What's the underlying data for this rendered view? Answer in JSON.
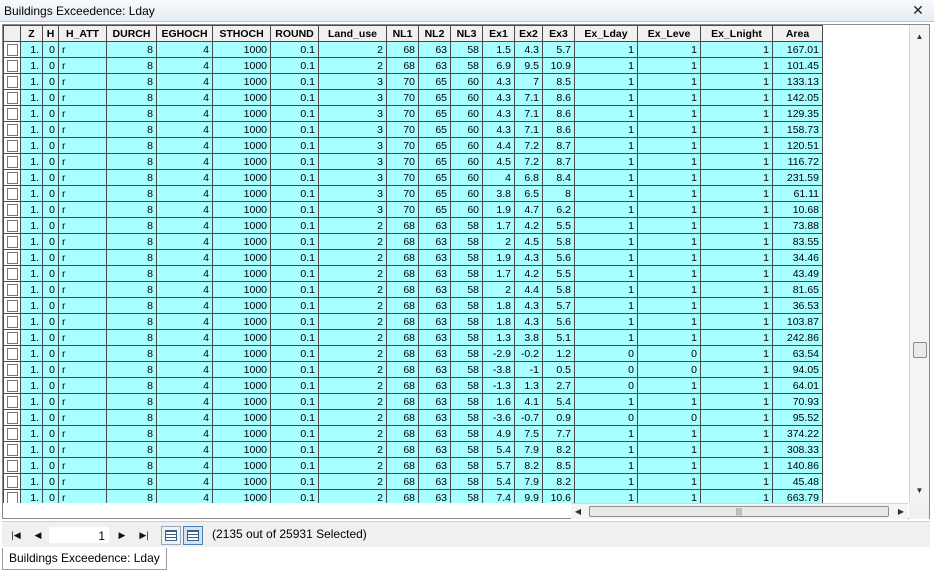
{
  "window": {
    "title": "Buildings Exceedence: Lday"
  },
  "table": {
    "columns": [
      "",
      "Z",
      "H",
      "H_ATT",
      "DURCH",
      "EGHOCH",
      "STHOCH",
      "ROUND",
      "Land_use",
      "NL1",
      "NL2",
      "NL3",
      "Ex1",
      "Ex2",
      "Ex3",
      "Ex_Lday",
      "Ex_Leve",
      "Ex_Lnight",
      "Area"
    ],
    "rows": [
      [
        "1.",
        "0",
        "r",
        "8",
        "4",
        "1000",
        "0.1",
        "2",
        "68",
        "63",
        "58",
        "1.5",
        "4.3",
        "5.7",
        "1",
        "1",
        "1",
        "167.01"
      ],
      [
        "1.",
        "0",
        "r",
        "8",
        "4",
        "1000",
        "0.1",
        "2",
        "68",
        "63",
        "58",
        "6.9",
        "9.5",
        "10.9",
        "1",
        "1",
        "1",
        "101.45"
      ],
      [
        "1.",
        "0",
        "r",
        "8",
        "4",
        "1000",
        "0.1",
        "3",
        "70",
        "65",
        "60",
        "4.3",
        "7",
        "8.5",
        "1",
        "1",
        "1",
        "133.13"
      ],
      [
        "1.",
        "0",
        "r",
        "8",
        "4",
        "1000",
        "0.1",
        "3",
        "70",
        "65",
        "60",
        "4.3",
        "7.1",
        "8.6",
        "1",
        "1",
        "1",
        "142.05"
      ],
      [
        "1.",
        "0",
        "r",
        "8",
        "4",
        "1000",
        "0.1",
        "3",
        "70",
        "65",
        "60",
        "4.3",
        "7.1",
        "8.6",
        "1",
        "1",
        "1",
        "129.35"
      ],
      [
        "1.",
        "0",
        "r",
        "8",
        "4",
        "1000",
        "0.1",
        "3",
        "70",
        "65",
        "60",
        "4.3",
        "7.1",
        "8.6",
        "1",
        "1",
        "1",
        "158.73"
      ],
      [
        "1.",
        "0",
        "r",
        "8",
        "4",
        "1000",
        "0.1",
        "3",
        "70",
        "65",
        "60",
        "4.4",
        "7.2",
        "8.7",
        "1",
        "1",
        "1",
        "120.51"
      ],
      [
        "1.",
        "0",
        "r",
        "8",
        "4",
        "1000",
        "0.1",
        "3",
        "70",
        "65",
        "60",
        "4.5",
        "7.2",
        "8.7",
        "1",
        "1",
        "1",
        "116.72"
      ],
      [
        "1.",
        "0",
        "r",
        "8",
        "4",
        "1000",
        "0.1",
        "3",
        "70",
        "65",
        "60",
        "4",
        "6.8",
        "8.4",
        "1",
        "1",
        "1",
        "231.59"
      ],
      [
        "1.",
        "0",
        "r",
        "8",
        "4",
        "1000",
        "0.1",
        "3",
        "70",
        "65",
        "60",
        "3.8",
        "6.5",
        "8",
        "1",
        "1",
        "1",
        "61.11"
      ],
      [
        "1.",
        "0",
        "r",
        "8",
        "4",
        "1000",
        "0.1",
        "3",
        "70",
        "65",
        "60",
        "1.9",
        "4.7",
        "6.2",
        "1",
        "1",
        "1",
        "10.68"
      ],
      [
        "1.",
        "0",
        "r",
        "8",
        "4",
        "1000",
        "0.1",
        "2",
        "68",
        "63",
        "58",
        "1.7",
        "4.2",
        "5.5",
        "1",
        "1",
        "1",
        "73.88"
      ],
      [
        "1.",
        "0",
        "r",
        "8",
        "4",
        "1000",
        "0.1",
        "2",
        "68",
        "63",
        "58",
        "2",
        "4.5",
        "5.8",
        "1",
        "1",
        "1",
        "83.55"
      ],
      [
        "1.",
        "0",
        "r",
        "8",
        "4",
        "1000",
        "0.1",
        "2",
        "68",
        "63",
        "58",
        "1.9",
        "4.3",
        "5.6",
        "1",
        "1",
        "1",
        "34.46"
      ],
      [
        "1.",
        "0",
        "r",
        "8",
        "4",
        "1000",
        "0.1",
        "2",
        "68",
        "63",
        "58",
        "1.7",
        "4.2",
        "5.5",
        "1",
        "1",
        "1",
        "43.49"
      ],
      [
        "1.",
        "0",
        "r",
        "8",
        "4",
        "1000",
        "0.1",
        "2",
        "68",
        "63",
        "58",
        "2",
        "4.4",
        "5.8",
        "1",
        "1",
        "1",
        "81.65"
      ],
      [
        "1.",
        "0",
        "r",
        "8",
        "4",
        "1000",
        "0.1",
        "2",
        "68",
        "63",
        "58",
        "1.8",
        "4.3",
        "5.7",
        "1",
        "1",
        "1",
        "36.53"
      ],
      [
        "1.",
        "0",
        "r",
        "8",
        "4",
        "1000",
        "0.1",
        "2",
        "68",
        "63",
        "58",
        "1.8",
        "4.3",
        "5.6",
        "1",
        "1",
        "1",
        "103.87"
      ],
      [
        "1.",
        "0",
        "r",
        "8",
        "4",
        "1000",
        "0.1",
        "2",
        "68",
        "63",
        "58",
        "1.3",
        "3.8",
        "5.1",
        "1",
        "1",
        "1",
        "242.86"
      ],
      [
        "1.",
        "0",
        "r",
        "8",
        "4",
        "1000",
        "0.1",
        "2",
        "68",
        "63",
        "58",
        "-2.9",
        "-0.2",
        "1.2",
        "0",
        "0",
        "1",
        "63.54"
      ],
      [
        "1.",
        "0",
        "r",
        "8",
        "4",
        "1000",
        "0.1",
        "2",
        "68",
        "63",
        "58",
        "-3.8",
        "-1",
        "0.5",
        "0",
        "0",
        "1",
        "94.05"
      ],
      [
        "1.",
        "0",
        "r",
        "8",
        "4",
        "1000",
        "0.1",
        "2",
        "68",
        "63",
        "58",
        "-1.3",
        "1.3",
        "2.7",
        "0",
        "1",
        "1",
        "64.01"
      ],
      [
        "1.",
        "0",
        "r",
        "8",
        "4",
        "1000",
        "0.1",
        "2",
        "68",
        "63",
        "58",
        "1.6",
        "4.1",
        "5.4",
        "1",
        "1",
        "1",
        "70.93"
      ],
      [
        "1.",
        "0",
        "r",
        "8",
        "4",
        "1000",
        "0.1",
        "2",
        "68",
        "63",
        "58",
        "-3.6",
        "-0.7",
        "0.9",
        "0",
        "0",
        "1",
        "95.52"
      ],
      [
        "1.",
        "0",
        "r",
        "8",
        "4",
        "1000",
        "0.1",
        "2",
        "68",
        "63",
        "58",
        "4.9",
        "7.5",
        "7.7",
        "1",
        "1",
        "1",
        "374.22"
      ],
      [
        "1.",
        "0",
        "r",
        "8",
        "4",
        "1000",
        "0.1",
        "2",
        "68",
        "63",
        "58",
        "5.4",
        "7.9",
        "8.2",
        "1",
        "1",
        "1",
        "308.33"
      ],
      [
        "1.",
        "0",
        "r",
        "8",
        "4",
        "1000",
        "0.1",
        "2",
        "68",
        "63",
        "58",
        "5.7",
        "8.2",
        "8.5",
        "1",
        "1",
        "1",
        "140.86"
      ],
      [
        "1.",
        "0",
        "r",
        "8",
        "4",
        "1000",
        "0.1",
        "2",
        "68",
        "63",
        "58",
        "5.4",
        "7.9",
        "8.2",
        "1",
        "1",
        "1",
        "45.48"
      ],
      [
        "1.",
        "0",
        "r",
        "8",
        "4",
        "1000",
        "0.1",
        "2",
        "68",
        "63",
        "58",
        "7.4",
        "9.9",
        "10.6",
        "1",
        "1",
        "1",
        "663.79"
      ]
    ]
  },
  "navigation": {
    "current_record": "1",
    "selection_status": "(2135 out of 25931 Selected)"
  },
  "tabs": [
    {
      "label": "Buildings Exceedence: Lday"
    }
  ],
  "icons": {
    "close": "close-icon",
    "first": "first-record-icon",
    "prev": "previous-record-icon",
    "next": "next-record-icon",
    "last": "last-record-icon",
    "show_all": "show-all-records-icon",
    "show_selected": "show-selected-records-icon"
  },
  "colors": {
    "row_selected_bg": "#a8ffff",
    "header_bg": "#f0f0f0"
  }
}
